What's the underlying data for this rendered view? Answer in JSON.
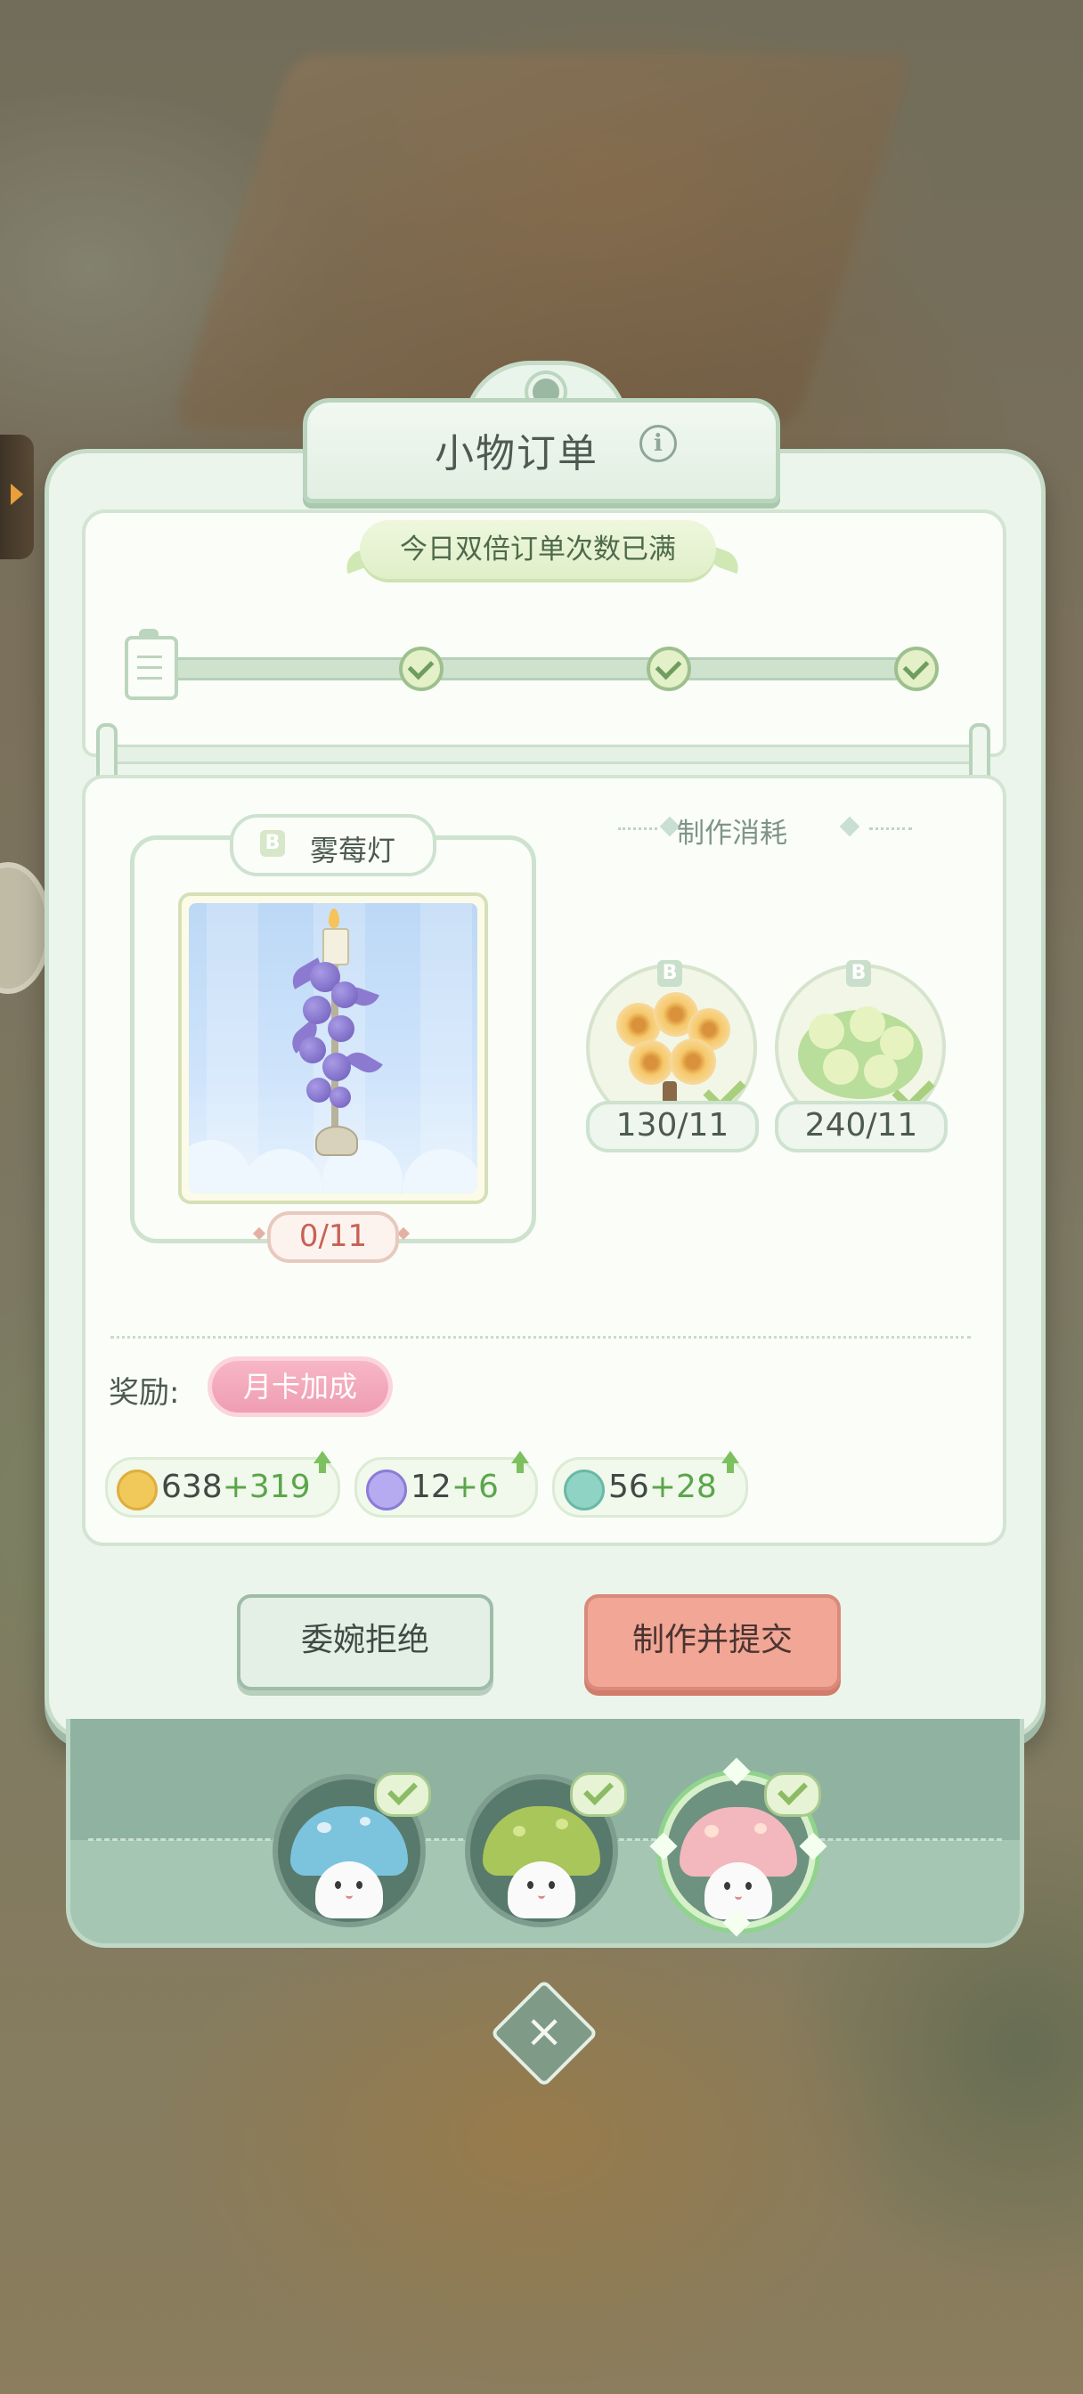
{
  "panel": {
    "title": "小物订单",
    "info_icon": "info-icon",
    "double_status": "今日双倍订单次数已满",
    "progress_nodes": 3
  },
  "order": {
    "item_grade": "B",
    "item_name": "雾莓灯",
    "item_progress": "0/11",
    "craft_cost_label": "制作消耗",
    "materials": [
      {
        "grade": "B",
        "count": "130/11",
        "icon": "orange-daisy-flower-icon",
        "ready": true
      },
      {
        "grade": "B",
        "count": "240/11",
        "icon": "green-clover-flower-icon",
        "ready": true
      }
    ]
  },
  "rewards": {
    "label": "奖励:",
    "monthly_bonus": "月卡加成",
    "items": [
      {
        "icon": "coin-icon",
        "base": "638",
        "bonus": "+319",
        "color": "#f0c95a"
      },
      {
        "icon": "gem-icon",
        "base": "12",
        "bonus": "+6",
        "color": "#9b8ce0"
      },
      {
        "icon": "exp-icon",
        "base": "56",
        "bonus": "+28",
        "color": "#8fd3c4"
      }
    ]
  },
  "buttons": {
    "reject": "委婉拒绝",
    "submit": "制作并提交"
  },
  "characters": [
    {
      "name": "blue-mushroom",
      "cap_color": "#7cc4de",
      "done": true
    },
    {
      "name": "green-mushroom",
      "cap_color": "#a8c65a",
      "done": true
    },
    {
      "name": "pink-mushroom",
      "cap_color": "#f2b8bd",
      "done": true,
      "selected": true
    }
  ],
  "colors": {
    "accent_green": "#5aa64a",
    "submit_button": "#f1a696",
    "panel_bg": "#ecf5ec",
    "progress_text": "#c76155"
  }
}
